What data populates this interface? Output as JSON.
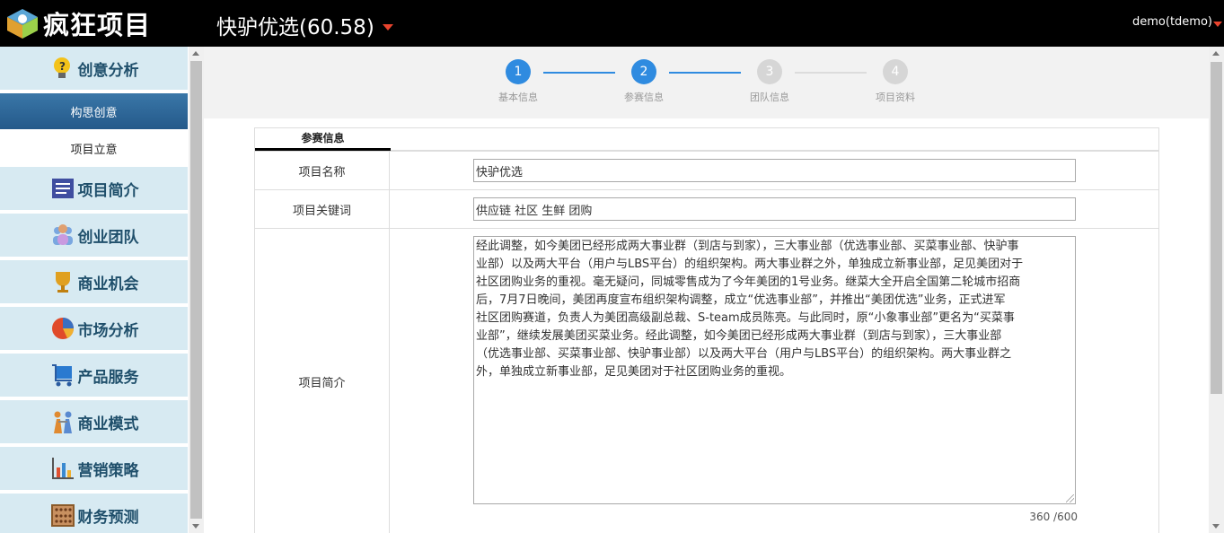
{
  "app": {
    "logo_text": "疯狂项目",
    "project_title": "快驴优选(60.58)",
    "user": "demo(tdemo)"
  },
  "colors": {
    "topbar": "#000000",
    "nav_bg": "#d7eaf2",
    "nav_active": "#2b5f8f",
    "accent": "#2f8be0",
    "caret": "#e8442e"
  },
  "sidebar": {
    "items": [
      {
        "label": "创意分析",
        "icon": "lightbulb-icon"
      },
      {
        "label": "项目简介",
        "icon": "document-icon"
      },
      {
        "label": "创业团队",
        "icon": "team-icon"
      },
      {
        "label": "商业机会",
        "icon": "trophy-icon"
      },
      {
        "label": "市场分析",
        "icon": "pie-chart-icon"
      },
      {
        "label": "产品服务",
        "icon": "cart-icon"
      },
      {
        "label": "商业模式",
        "icon": "people-icon"
      },
      {
        "label": "营销策略",
        "icon": "bar-chart-icon"
      },
      {
        "label": "财务预测",
        "icon": "abacus-icon"
      }
    ],
    "sub_items": [
      {
        "label": "构思创意",
        "active": true
      },
      {
        "label": "项目立意",
        "active": false
      }
    ]
  },
  "steps": [
    {
      "num": "1",
      "label": "基本信息",
      "state": "active"
    },
    {
      "num": "2",
      "label": "参赛信息",
      "state": "active"
    },
    {
      "num": "3",
      "label": "团队信息",
      "state": "inactive"
    },
    {
      "num": "4",
      "label": "项目资料",
      "state": "inactive"
    }
  ],
  "form": {
    "tab": "参赛信息",
    "name_label": "项目名称",
    "name_value": "快驴优选",
    "keywords_label": "项目关键词",
    "keywords_value": "供应链 社区 生鲜 团购",
    "intro_label": "项目简介",
    "intro_lines": [
      "经此调整，如今美团已经形成两大事业群（到店与到家），三大事业部（优选事业部、买菜事业部、快驴事",
      "业部）以及两大平台（用户与LBS平台）的组织架构。两大事业群之外，单独成立新事业部，足见美团对于",
      "社区团购业务的重视。毫无疑问，同城零售成为了今年美团的1号业务。继菜大全开启全国第二轮城市招商",
      "后，7月7日晚间，美团再度宣布组织架构调整，成立“优选事业部”，并推出“美团优选”业务，正式进军",
      "社区团购赛道，负责人为美团高级副总裁、S-team成员陈亮。与此同时，原“小象事业部”更名为“买菜事",
      "业部”，继续发展美团买菜业务。经此调整，如今美团已经形成两大事业群（到店与到家），三大事业部",
      "（优选事业部、买菜事业部、快驴事业部）以及两大平台（用户与LBS平台）的组织架构。两大事业群之",
      "外，单独成立新事业部，足见美团对于社区团购业务的重视。"
    ],
    "counter": "360 /600"
  }
}
